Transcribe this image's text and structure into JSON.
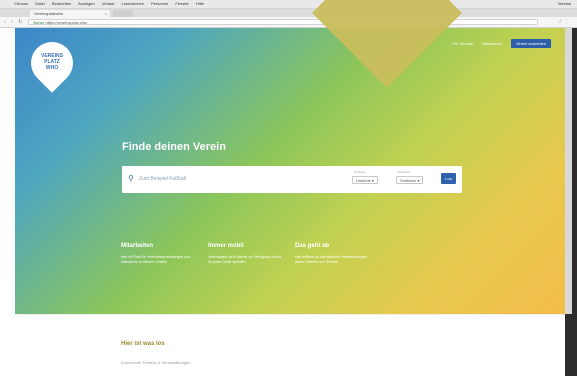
{
  "os_menu": {
    "apple": "",
    "items": [
      "Chrome",
      "Datei",
      "Bearbeiten",
      "Anzeigen",
      "Verlauf",
      "Lesezeichen",
      "Personen",
      "Fenster",
      "Hilfe"
    ],
    "right": "Vereins"
  },
  "browser": {
    "tab_title": "Vereinsplatzwho",
    "tab_close": "×",
    "nav": "‹ › ↻",
    "url_secure": "Sicher",
    "url_path": "https://vereinsplatz.who",
    "icons": "☆ ⋮"
  },
  "site": {
    "logo_lines": [
      "VEREINS",
      "PLATZ",
      "WHO"
    ],
    "nav": {
      "link1": "Für Vereine",
      "link2": "Mitmachen",
      "cta": "Verein anmelden"
    },
    "headline": "Finde deinen Verein",
    "search": {
      "icon": "search-icon",
      "placeholder": "Zum Beispiel Fußball",
      "filter1_label": "Umkreis",
      "filter1_value": "Umkreis",
      "filter2_label": "Sortieren",
      "filter2_value": "Sortieren",
      "button": "Los"
    },
    "features": [
      {
        "title": "Mitarbeiten",
        "text": "Hier ist Platz für Vereinsbeschreibungen und Mitmachen in deinem Umfeld."
      },
      {
        "title": "Immer mobil",
        "text": "Vereinsplatz steht überall zur Verfügung und ist für jedes Gerät optimiert."
      },
      {
        "title": "Das geht ab",
        "text": "Hier erfährst du alle aktuellen Veranstaltungen deiner Vereine und Termine."
      }
    ],
    "lower": {
      "title": "Hier ist was los",
      "subtitle": "Kommende Termine & Veranstaltungen"
    }
  },
  "colors": {
    "hero_blue": "#3c86c9",
    "hero_green": "#8cc65a",
    "hero_yellow": "#f2bd4a",
    "diamond": "#c9bd5d",
    "brand_blue": "#2f62ac"
  }
}
